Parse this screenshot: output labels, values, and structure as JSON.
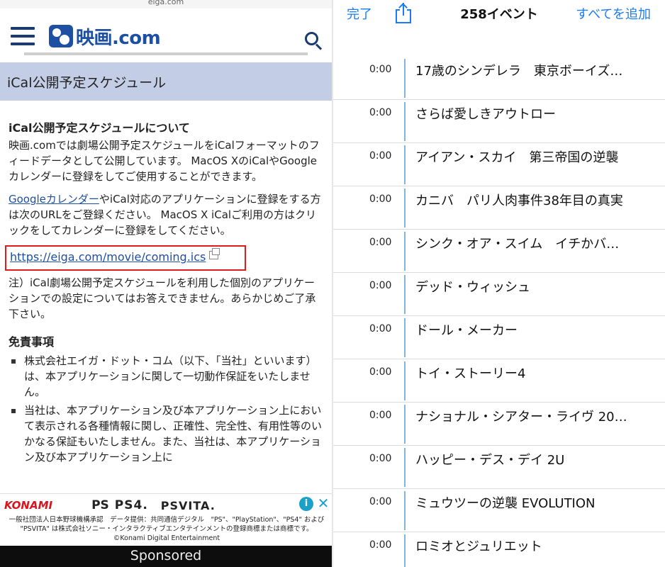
{
  "left": {
    "url_host": "eiga.com",
    "logo_text": "映画.com",
    "page_title": "iCal公開予定スケジュール",
    "about_heading": "iCal公開予定スケジュールについて",
    "about_text": "映画.comでは劇場公開予定スケジュールをiCalフォーマットのフィードデータとして公開しています。 MacOS XのiCalやGoogleカレンダーに登録をしてご使用することができます。",
    "google_link": "Googleカレンダー",
    "register_text": "やiCal対応のアプリケーションに登録をする方は次のURLをご登録ください。 MacOS X iCalご利用の方はクリックをしてカレンダーに登録をしてください。",
    "ics_url": "https://eiga.com/movie/coming.ics",
    "note_text": "注）iCal劇場公開予定スケジュールを利用した個別のアプリケーションでの設定についてはお答えできません。あらかじめご了承下さい。",
    "disclaimer_heading": "免責事項",
    "disclaimer_items": [
      "株式会社エイガ・ドット・コム（以下、「当社」といいます）は、本アプリケーションに関して一切動作保証をいたしません。",
      "当社は、本アプリケーション及び本アプリケーション上において表示される各種情報に関し、正確性、完全性、有用性等のいかなる保証もいたしません。また、当社は、本アプリケーション及び本アプリケーション上に"
    ],
    "ad": {
      "konami": "KONAMI",
      "ps_mark": "PS",
      "ps4": "PS4.",
      "psvita": "PSVITA.",
      "adchoice": "i",
      "close": "✕",
      "fine_line1": "一般社団法人日本野球機構承認　データ提供：共同通信デジタル　\"PS\"、\"PlayStation\"、\"PS4\" および",
      "fine_line2": "\"PSVITA\" は株式会社ソニー・インタラクティブエンタテインメントの登録商標または商標です。",
      "fine_line3": "©Konami Digital Entertainment"
    },
    "sponsored": "Sponsored"
  },
  "right": {
    "done": "完了",
    "title": "258イベント",
    "add_all": "すべてを追加",
    "events": [
      {
        "time": "0:00",
        "title": "17歳のシンデレラ　東京ボーイズ…"
      },
      {
        "time": "0:00",
        "title": "さらば愛しきアウトロー"
      },
      {
        "time": "0:00",
        "title": "アイアン・スカイ　第三帝国の逆襲"
      },
      {
        "time": "0:00",
        "title": "カニバ　パリ人肉事件38年目の真実"
      },
      {
        "time": "0:00",
        "title": "シンク・オア・スイム　イチかバ…"
      },
      {
        "time": "0:00",
        "title": "デッド・ウィッシュ"
      },
      {
        "time": "0:00",
        "title": "ドール・メーカー"
      },
      {
        "time": "0:00",
        "title": "トイ・ストーリー4"
      },
      {
        "time": "0:00",
        "title": "ナショナル・シアター・ライヴ 20…"
      },
      {
        "time": "0:00",
        "title": "ハッピー・デス・デイ 2U"
      },
      {
        "time": "0:00",
        "title": "ミュウツーの逆襲 EVOLUTION"
      },
      {
        "time": "0:00",
        "title": "ロミオとジュリエット"
      }
    ]
  }
}
